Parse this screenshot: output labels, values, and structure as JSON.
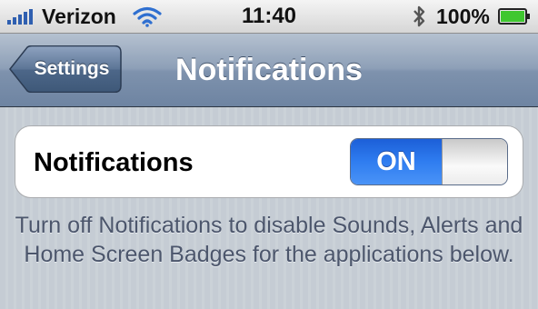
{
  "status_bar": {
    "carrier": "Verizon",
    "time": "11:40",
    "battery_percent": "100%",
    "signal_bars": 5,
    "battery_level": 1.0,
    "battery_color": "#3fc72f"
  },
  "nav_bar": {
    "back_label": "Settings",
    "title": "Notifications"
  },
  "cell": {
    "label": "Notifications",
    "toggle_state_label": "ON",
    "toggle_on": true,
    "toggle_color": "#2f7df0"
  },
  "footer": {
    "text": "Turn off Notifications to disable Sounds, Alerts and Home Screen Badges for the applications below."
  }
}
